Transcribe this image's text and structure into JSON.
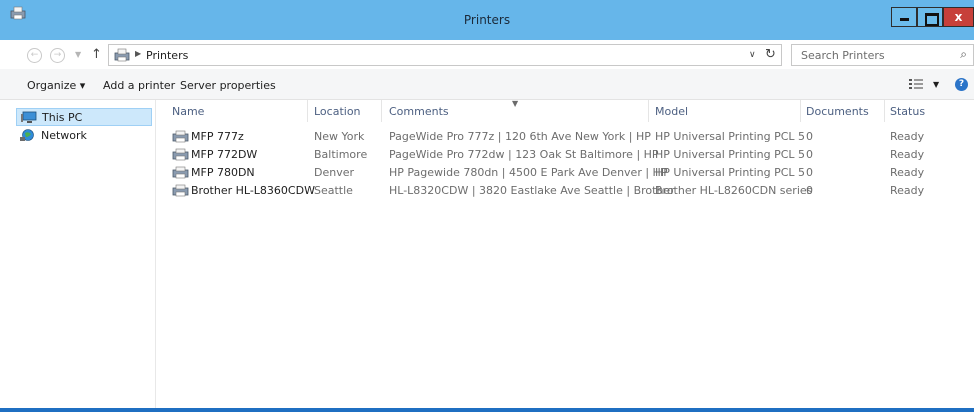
{
  "window": {
    "title": "Printers"
  },
  "window_controls": {
    "close": "x"
  },
  "address": {
    "path": "Printers"
  },
  "search": {
    "placeholder": "Search Printers"
  },
  "toolbar": {
    "organize": "Organize ▾",
    "add_printer": "Add a printer",
    "server_properties": "Server properties"
  },
  "sidebar": {
    "items": [
      {
        "label": "This PC"
      },
      {
        "label": "Network"
      }
    ]
  },
  "columns": {
    "name": "Name",
    "location": "Location",
    "comments": "Comments",
    "model": "Model",
    "documents": "Documents",
    "status": "Status"
  },
  "printers": [
    {
      "name": "MFP 777z",
      "location": "New York",
      "comments": "PageWide Pro 777z | 120 6th Ave New York | HP",
      "model": "HP Universal Printing PCL 5",
      "documents": "0",
      "status": "Ready"
    },
    {
      "name": "MFP 772DW",
      "location": "Baltimore",
      "comments": "PageWide Pro 772dw | 123 Oak St Baltimore | HP",
      "model": "HP Universal Printing PCL 5",
      "documents": "0",
      "status": "Ready"
    },
    {
      "name": "MFP 780DN",
      "location": "Denver",
      "comments": "HP Pagewide 780dn | 4500 E Park Ave Denver | HP",
      "model": "HP Universal Printing PCL 5",
      "documents": "0",
      "status": "Ready"
    },
    {
      "name": "Brother HL-L8360CDW",
      "location": "Seattle",
      "comments": "HL-L8320CDW | 3820 Eastlake Ave Seattle | Brother",
      "model": "Brother HL-L8260CDN series",
      "documents": "0",
      "status": "Ready"
    }
  ],
  "colors": {
    "titlebar": "#66b6ea",
    "close_button": "#c7403a",
    "selection": "#cde8fb",
    "header_text": "#4d6082"
  }
}
